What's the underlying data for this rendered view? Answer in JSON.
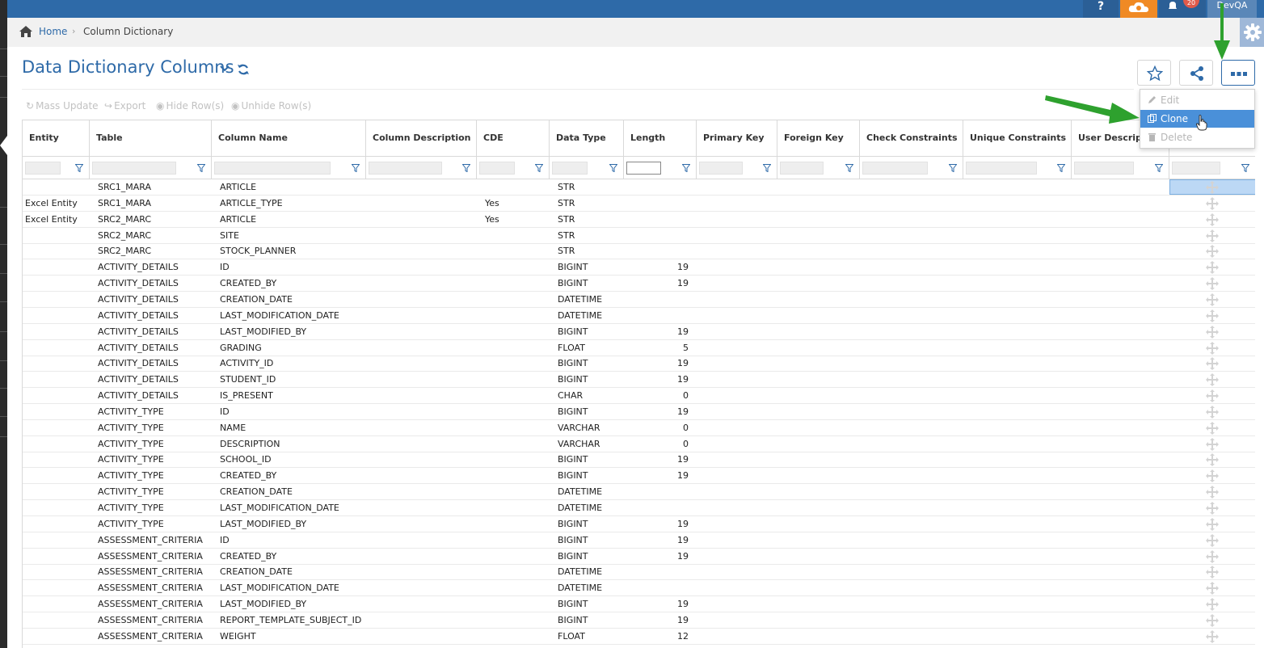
{
  "topbar": {
    "help": "?",
    "notifications_badge": "20",
    "user": "DevQA"
  },
  "breadcrumb": {
    "home": "Home",
    "separator": "›",
    "current": "Column Dictionary"
  },
  "page": {
    "title": "Data Dictionary Columns"
  },
  "toolbar": {
    "mass_update": "Mass Update",
    "export": "Export",
    "hide_rows": "Hide Row(s)",
    "unhide_rows": "Unhide Row(s)"
  },
  "menu": {
    "edit": "Edit",
    "clone": "Clone",
    "delete": "Delete"
  },
  "columns": [
    "Entity",
    "Table",
    "Column Name",
    "Column Description",
    "CDE",
    "Data Type",
    "Length",
    "Primary Key",
    "Foreign Key",
    "Check Constraints",
    "Unique Constraints",
    "User Description",
    ""
  ],
  "rows": [
    {
      "entity": "",
      "table": "SRC1_MARA",
      "column": "ARTICLE",
      "cde": "",
      "type": "STR",
      "length": ""
    },
    {
      "entity": "Excel Entity",
      "table": "SRC1_MARA",
      "column": "ARTICLE_TYPE",
      "cde": "Yes",
      "type": "STR",
      "length": ""
    },
    {
      "entity": "Excel Entity",
      "table": "SRC2_MARC",
      "column": "ARTICLE",
      "cde": "Yes",
      "type": "STR",
      "length": ""
    },
    {
      "entity": "",
      "table": "SRC2_MARC",
      "column": "SITE",
      "cde": "",
      "type": "STR",
      "length": ""
    },
    {
      "entity": "",
      "table": "SRC2_MARC",
      "column": "STOCK_PLANNER",
      "cde": "",
      "type": "STR",
      "length": ""
    },
    {
      "entity": "",
      "table": "ACTIVITY_DETAILS",
      "column": "ID",
      "cde": "",
      "type": "BIGINT",
      "length": "19"
    },
    {
      "entity": "",
      "table": "ACTIVITY_DETAILS",
      "column": "CREATED_BY",
      "cde": "",
      "type": "BIGINT",
      "length": "19"
    },
    {
      "entity": "",
      "table": "ACTIVITY_DETAILS",
      "column": "CREATION_DATE",
      "cde": "",
      "type": "DATETIME",
      "length": ""
    },
    {
      "entity": "",
      "table": "ACTIVITY_DETAILS",
      "column": "LAST_MODIFICATION_DATE",
      "cde": "",
      "type": "DATETIME",
      "length": ""
    },
    {
      "entity": "",
      "table": "ACTIVITY_DETAILS",
      "column": "LAST_MODIFIED_BY",
      "cde": "",
      "type": "BIGINT",
      "length": "19"
    },
    {
      "entity": "",
      "table": "ACTIVITY_DETAILS",
      "column": "GRADING",
      "cde": "",
      "type": "FLOAT",
      "length": "5"
    },
    {
      "entity": "",
      "table": "ACTIVITY_DETAILS",
      "column": "ACTIVITY_ID",
      "cde": "",
      "type": "BIGINT",
      "length": "19"
    },
    {
      "entity": "",
      "table": "ACTIVITY_DETAILS",
      "column": "STUDENT_ID",
      "cde": "",
      "type": "BIGINT",
      "length": "19"
    },
    {
      "entity": "",
      "table": "ACTIVITY_DETAILS",
      "column": "IS_PRESENT",
      "cde": "",
      "type": "CHAR",
      "length": "0"
    },
    {
      "entity": "",
      "table": "ACTIVITY_TYPE",
      "column": "ID",
      "cde": "",
      "type": "BIGINT",
      "length": "19"
    },
    {
      "entity": "",
      "table": "ACTIVITY_TYPE",
      "column": "NAME",
      "cde": "",
      "type": "VARCHAR",
      "length": "0"
    },
    {
      "entity": "",
      "table": "ACTIVITY_TYPE",
      "column": "DESCRIPTION",
      "cde": "",
      "type": "VARCHAR",
      "length": "0"
    },
    {
      "entity": "",
      "table": "ACTIVITY_TYPE",
      "column": "SCHOOL_ID",
      "cde": "",
      "type": "BIGINT",
      "length": "19"
    },
    {
      "entity": "",
      "table": "ACTIVITY_TYPE",
      "column": "CREATED_BY",
      "cde": "",
      "type": "BIGINT",
      "length": "19"
    },
    {
      "entity": "",
      "table": "ACTIVITY_TYPE",
      "column": "CREATION_DATE",
      "cde": "",
      "type": "DATETIME",
      "length": ""
    },
    {
      "entity": "",
      "table": "ACTIVITY_TYPE",
      "column": "LAST_MODIFICATION_DATE",
      "cde": "",
      "type": "DATETIME",
      "length": ""
    },
    {
      "entity": "",
      "table": "ACTIVITY_TYPE",
      "column": "LAST_MODIFIED_BY",
      "cde": "",
      "type": "BIGINT",
      "length": "19"
    },
    {
      "entity": "",
      "table": "ASSESSMENT_CRITERIA",
      "column": "ID",
      "cde": "",
      "type": "BIGINT",
      "length": "19"
    },
    {
      "entity": "",
      "table": "ASSESSMENT_CRITERIA",
      "column": "CREATED_BY",
      "cde": "",
      "type": "BIGINT",
      "length": "19"
    },
    {
      "entity": "",
      "table": "ASSESSMENT_CRITERIA",
      "column": "CREATION_DATE",
      "cde": "",
      "type": "DATETIME",
      "length": ""
    },
    {
      "entity": "",
      "table": "ASSESSMENT_CRITERIA",
      "column": "LAST_MODIFICATION_DATE",
      "cde": "",
      "type": "DATETIME",
      "length": ""
    },
    {
      "entity": "",
      "table": "ASSESSMENT_CRITERIA",
      "column": "LAST_MODIFIED_BY",
      "cde": "",
      "type": "BIGINT",
      "length": "19"
    },
    {
      "entity": "",
      "table": "ASSESSMENT_CRITERIA",
      "column": "REPORT_TEMPLATE_SUBJECT_ID",
      "cde": "",
      "type": "BIGINT",
      "length": "19"
    },
    {
      "entity": "",
      "table": "ASSESSMENT_CRITERIA",
      "column": "WEIGHT",
      "cde": "",
      "type": "FLOAT",
      "length": "12"
    }
  ],
  "colors": {
    "brand_blue": "#2e6aa8",
    "accent_orange": "#f08a24",
    "menu_highlight": "#4a90d9",
    "annotation_arrow": "#2ea12e"
  }
}
